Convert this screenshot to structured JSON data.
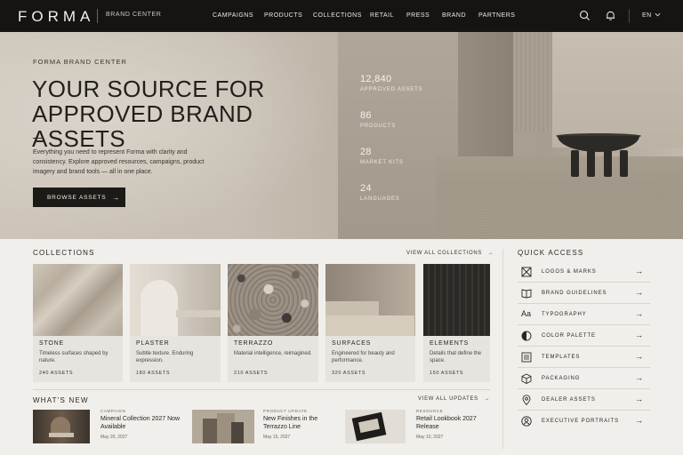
{
  "nav": {
    "logo": "FORMA",
    "subtitle": "BRAND CENTER",
    "links": [
      "CAMPAIGNS",
      "PRODUCTS",
      "COLLECTIONS",
      "RETAIL",
      "PRESS",
      "BRAND",
      "PARTNERS"
    ],
    "language": "EN"
  },
  "hero": {
    "eyebrow": "FORMA BRAND CENTER",
    "title_line1": "YOUR SOURCE FOR",
    "title_line2": "APPROVED BRAND ASSETS",
    "description": "Everything you need to represent Forma with clarity and consistency. Explore approved resources, campaigns, product imagery and brand tools — all in one place.",
    "button": "BROWSE ASSETS",
    "stats": [
      {
        "value": "12,840",
        "label": "APPROVED ASSETS"
      },
      {
        "value": "86",
        "label": "PRODUCTS"
      },
      {
        "value": "28",
        "label": "MARKET KITS"
      },
      {
        "value": "24",
        "label": "LANGUAGES"
      }
    ]
  },
  "collections": {
    "title": "COLLECTIONS",
    "view_all": "VIEW ALL COLLECTIONS",
    "items": [
      {
        "name": "STONE",
        "desc": "Timeless surfaces shaped by nature.",
        "count": "240 ASSETS"
      },
      {
        "name": "PLASTER",
        "desc": "Subtle texture. Enduring expression.",
        "count": "180 ASSETS"
      },
      {
        "name": "TERRAZZO",
        "desc": "Material intelligence, reimagined.",
        "count": "210 ASSETS"
      },
      {
        "name": "SURFACES",
        "desc": "Engineered for beauty and performance.",
        "count": "320 ASSETS"
      },
      {
        "name": "ELEMENTS",
        "desc": "Details that define the space.",
        "count": "150 ASSETS"
      }
    ]
  },
  "whats_new": {
    "title": "WHAT'S NEW",
    "view_all": "VIEW ALL UPDATES",
    "items": [
      {
        "tag": "CAMPAIGN",
        "title": "Mineral Collection 2027 Now Available",
        "date": "May 20, 2027"
      },
      {
        "tag": "PRODUCT UPDATE",
        "title": "New Finishes in the Terrazzo Line",
        "date": "May 15, 2027"
      },
      {
        "tag": "RESOURCE",
        "title": "Retail Lookbook 2027 Release",
        "date": "May 10, 2027"
      }
    ]
  },
  "quick_access": {
    "title": "QUICK ACCESS",
    "items": [
      {
        "label": "LOGOS & MARKS",
        "icon": "logo-mark-icon"
      },
      {
        "label": "BRAND GUIDELINES",
        "icon": "book-icon"
      },
      {
        "label": "TYPOGRAPHY",
        "icon": "type-icon"
      },
      {
        "label": "COLOR PALETTE",
        "icon": "half-circle-icon"
      },
      {
        "label": "TEMPLATES",
        "icon": "template-icon"
      },
      {
        "label": "PACKAGING",
        "icon": "box-icon"
      },
      {
        "label": "DEALER ASSETS",
        "icon": "map-pin-icon"
      },
      {
        "label": "EXECUTIVE PORTRAITS",
        "icon": "person-icon"
      }
    ]
  }
}
